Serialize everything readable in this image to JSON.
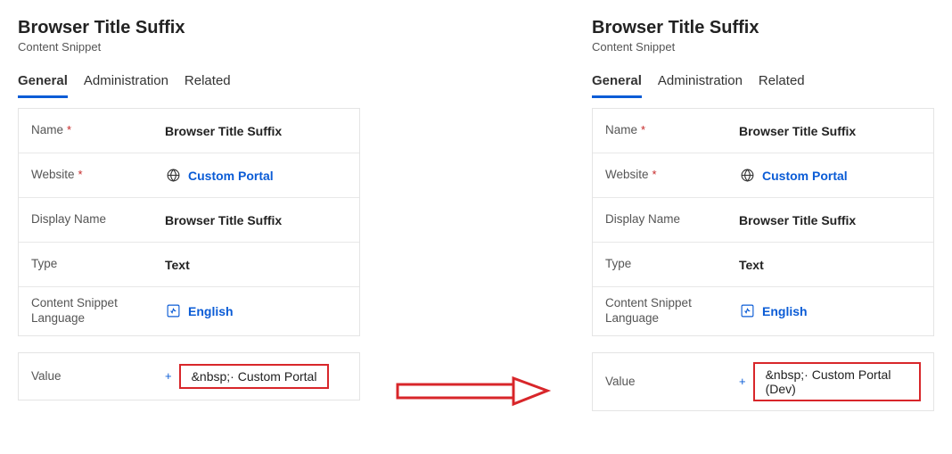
{
  "left": {
    "title": "Browser Title Suffix",
    "subtitle": "Content Snippet",
    "tabs": {
      "general": "General",
      "administration": "Administration",
      "related": "Related"
    },
    "fields": {
      "name_label": "Name",
      "name_value": "Browser Title Suffix",
      "website_label": "Website",
      "website_value": "Custom Portal",
      "display_name_label": "Display Name",
      "display_name_value": "Browser Title Suffix",
      "type_label": "Type",
      "type_value": "Text",
      "language_label": "Content Snippet Language",
      "language_value": "English",
      "value_label": "Value",
      "value_value": "&nbsp;· Custom Portal"
    }
  },
  "right": {
    "title": "Browser Title Suffix",
    "subtitle": "Content Snippet",
    "tabs": {
      "general": "General",
      "administration": "Administration",
      "related": "Related"
    },
    "fields": {
      "name_label": "Name",
      "name_value": "Browser Title Suffix",
      "website_label": "Website",
      "website_value": "Custom Portal",
      "display_name_label": "Display Name",
      "display_name_value": "Browser Title Suffix",
      "type_label": "Type",
      "type_value": "Text",
      "language_label": "Content Snippet Language",
      "language_value": "English",
      "value_label": "Value",
      "value_value": "&nbsp;· Custom Portal (Dev)"
    }
  },
  "required_marker": "*",
  "plus_marker": "+"
}
